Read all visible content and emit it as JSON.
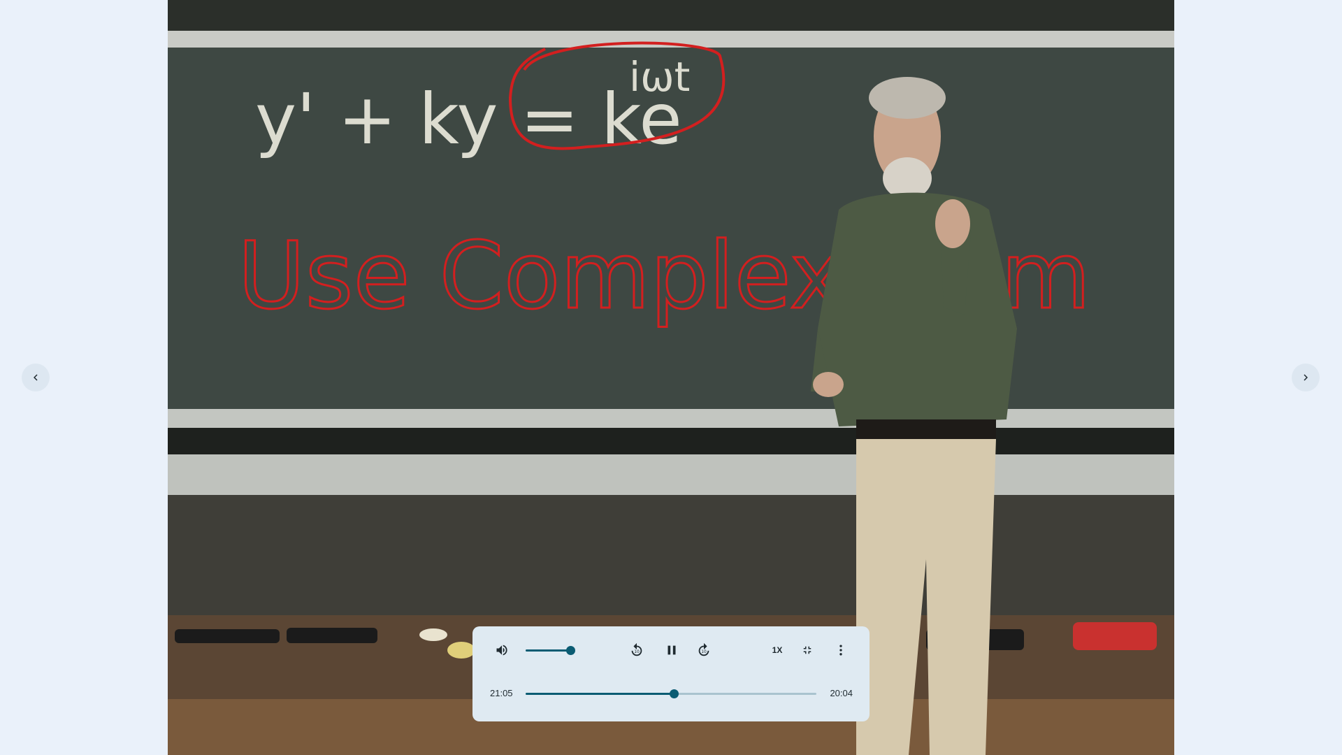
{
  "video": {
    "board_equation": "y' + ky = ke",
    "board_exponent": "iωt",
    "annotation": "Use Complex Num"
  },
  "navigation": {
    "prev_icon": "chevron-left-icon",
    "next_icon": "chevron-right-icon"
  },
  "player": {
    "volume_icon": "volume-up-icon",
    "volume_level": 0.92,
    "rewind_icon": "replay-10-icon",
    "play_state_icon": "pause-icon",
    "forward_icon": "forward-10-icon",
    "speed_label": "1X",
    "fullscreen_icon": "fullscreen-exit-icon",
    "more_icon": "more-vert-icon",
    "elapsed": "21:05",
    "remaining": "20:04",
    "progress": 0.51,
    "accent_color": "#0b5c73"
  }
}
